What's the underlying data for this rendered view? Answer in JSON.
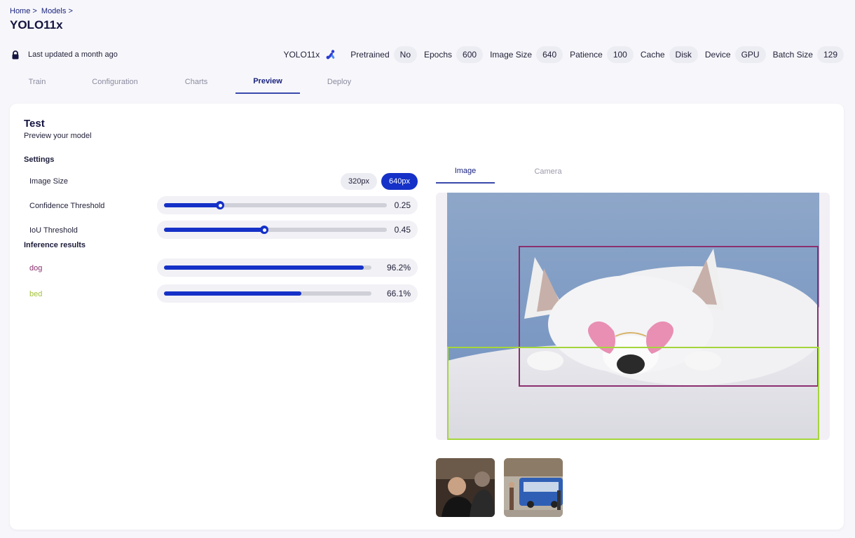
{
  "breadcrumb": {
    "home": "Home",
    "sep1": ">",
    "models": "Models",
    "sep2": ">"
  },
  "page_title": "YOLO11x",
  "last_updated": "Last updated a month ago",
  "meta": {
    "model": "YOLO11x",
    "pretrained_label": "Pretrained",
    "pretrained_value": "No",
    "epochs_label": "Epochs",
    "epochs_value": "600",
    "image_size_label": "Image Size",
    "image_size_value": "640",
    "patience_label": "Patience",
    "patience_value": "100",
    "cache_label": "Cache",
    "cache_value": "Disk",
    "device_label": "Device",
    "device_value": "GPU",
    "batch_label": "Batch Size",
    "batch_value": "129"
  },
  "tabs": [
    "Train",
    "Configuration",
    "Charts",
    "Preview",
    "Deploy"
  ],
  "active_tab": "Preview",
  "test": {
    "title": "Test",
    "subtitle": "Preview your model",
    "settings_label": "Settings",
    "image_size_label": "Image Size",
    "size_options": [
      "320px",
      "640px"
    ],
    "size_selected": "640px",
    "confidence_label": "Confidence Threshold",
    "confidence_value": "0.25",
    "confidence_fraction": 0.25,
    "iou_label": "IoU Threshold",
    "iou_value": "0.45",
    "iou_fraction": 0.45,
    "inference_label": "Inference results",
    "results": [
      {
        "label": "dog",
        "value": "96.2%",
        "fraction": 0.962,
        "color": "#8b2f6e"
      },
      {
        "label": "bed",
        "value": "66.1%",
        "fraction": 0.661,
        "color": "#a4c43a"
      }
    ]
  },
  "preview": {
    "subtabs": [
      "Image",
      "Camera"
    ],
    "active_subtab": "Image"
  },
  "colors": {
    "accent": "#1531c7",
    "dog_box": "#8b2f6e",
    "bed_box": "#a4d63a"
  },
  "icons": [
    "lock-icon",
    "model-logo-icon"
  ]
}
